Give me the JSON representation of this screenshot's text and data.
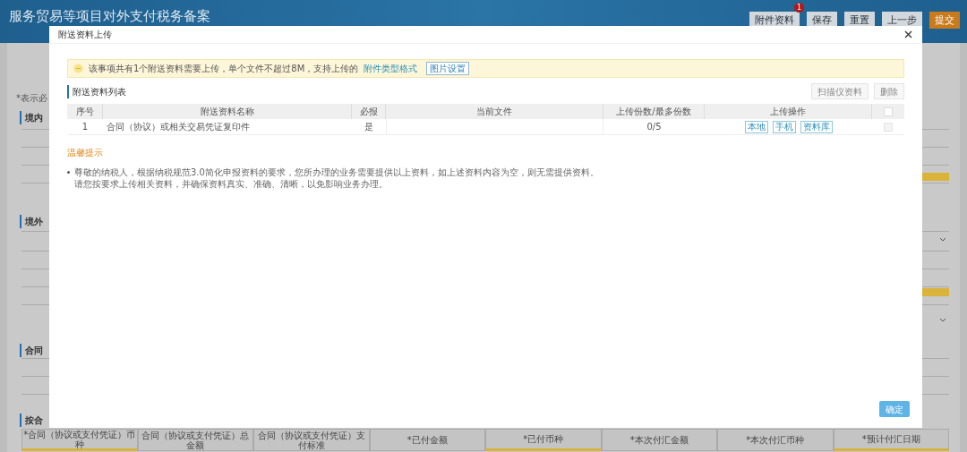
{
  "page": {
    "title": "服务贸易等项目对外支付税务备案",
    "buttons": [
      {
        "label": "附件资料",
        "kind": "default",
        "badge": "1"
      },
      {
        "label": "保存",
        "kind": "default"
      },
      {
        "label": "重置",
        "kind": "default"
      },
      {
        "label": "上一步",
        "kind": "default"
      },
      {
        "label": "提交",
        "kind": "primary"
      }
    ],
    "required_note": "*表示必",
    "sections": [
      {
        "label": "境内"
      },
      {
        "label": "境外"
      },
      {
        "label": "合同"
      },
      {
        "label": "按合"
      }
    ],
    "bottom_table": {
      "columns": [
        {
          "label": "*合同（协议或支付凭证）币种",
          "highlighted": true
        },
        {
          "label": "合同（协议或支付凭证）总金额",
          "highlighted": false
        },
        {
          "label": "合同（协议或支付凭证）支付标准",
          "highlighted": false
        },
        {
          "label": "*已付金额",
          "highlighted": false
        },
        {
          "label": "*已付币种",
          "highlighted": true
        },
        {
          "label": "*本次付汇金额",
          "highlighted": false
        },
        {
          "label": "*本次付汇币种",
          "highlighted": false
        },
        {
          "label": "*预计付汇日期",
          "highlighted": true
        }
      ]
    }
  },
  "dialog": {
    "title": "附送资料上传",
    "notice": {
      "text": "该事项共有1个附送资料需要上传，单个文件不超过8M，支持上传的",
      "link": "附件类型格式",
      "button": "图片设置"
    },
    "list_title": "附送资料列表",
    "toolbar": [
      {
        "label": "扫描仪资料",
        "disabled": true
      },
      {
        "label": "删除",
        "disabled": true
      }
    ],
    "table": {
      "columns": [
        "序号",
        "附送资料名称",
        "必报",
        "当前文件",
        "上传份数/最多份数",
        "上传操作"
      ],
      "select_all_checked": false,
      "rows": [
        {
          "index": "1",
          "name": "合同（协议）或相关交易凭证复印件",
          "required": "是",
          "count": "0/5",
          "actions": [
            "本地",
            "手机",
            "资料库"
          ],
          "checked": false,
          "disabled": true
        }
      ]
    },
    "tips_title": "温馨提示",
    "tips": [
      "尊敬的纳税人，根据纳税规范3.0简化申报资料的要求，您所办理的业务需要提供以上资料，如上述资料内容为空，则无需提供资料。",
      "请您按要求上传相关资料，并确保资料真实、准确、清晰，以免影响业务办理。"
    ],
    "confirm": "确定"
  }
}
